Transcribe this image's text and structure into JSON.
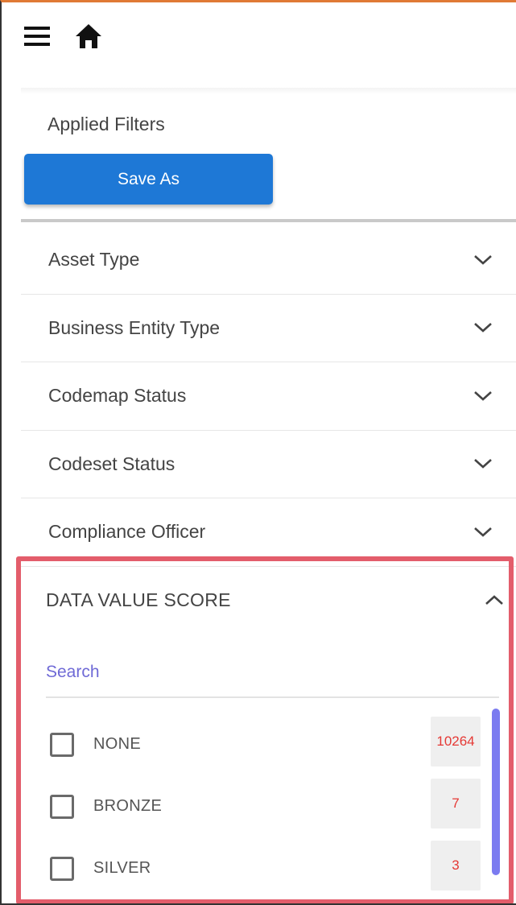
{
  "header": {
    "menu_icon": "hamburger-menu-icon",
    "home_icon": "home-icon"
  },
  "applied_filters": {
    "title": "Applied Filters",
    "save_as_label": "Save As"
  },
  "filters": [
    {
      "label": "Asset Type",
      "icon": "chevron-down-icon"
    },
    {
      "label": "Business Entity Type",
      "icon": "chevron-down-icon"
    },
    {
      "label": "Codemap Status",
      "icon": "chevron-down-icon"
    },
    {
      "label": "Codeset Status",
      "icon": "chevron-down-icon"
    },
    {
      "label": "Compliance Officer",
      "icon": "chevron-down-icon"
    }
  ],
  "data_value_score": {
    "title": "DATA VALUE SCORE",
    "icon": "chevron-up-icon",
    "search_placeholder": "Search",
    "options": [
      {
        "label": "NONE",
        "count": "10264",
        "checked": false
      },
      {
        "label": "BRONZE",
        "count": "7",
        "checked": false
      },
      {
        "label": "SILVER",
        "count": "3",
        "checked": false
      }
    ]
  },
  "colors": {
    "primary_button": "#1e78d6",
    "highlight_border": "#e35d6b",
    "count_text": "#e53935",
    "scrollbar": "#7b7bf0",
    "search_placeholder": "#6f6ad6"
  }
}
